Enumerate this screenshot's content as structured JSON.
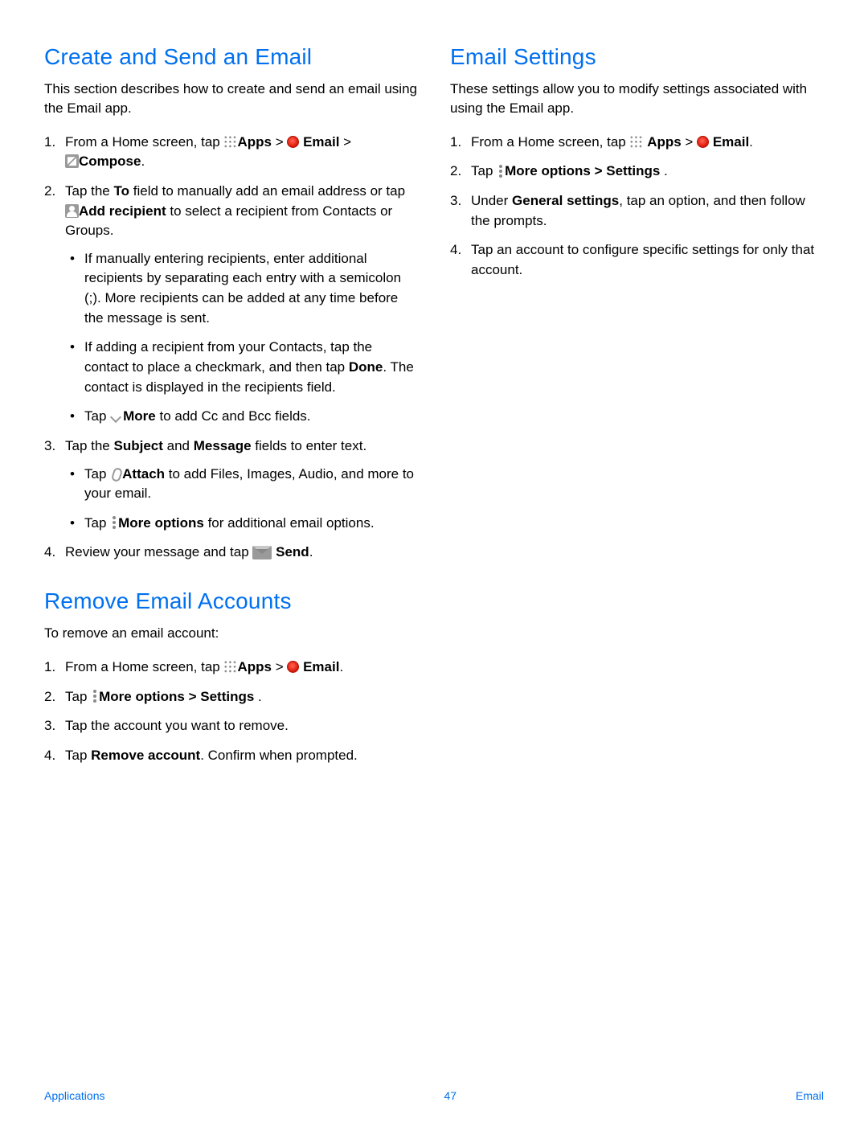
{
  "left": {
    "section1": {
      "heading": "Create and Send an Email",
      "intro": "This section describes how to create and send an email using the Email app.",
      "step1_a": "From a Home screen, tap ",
      "apps": "Apps",
      "gt": " > ",
      "email": "Email",
      "compose": "Compose",
      "period": ".",
      "step2_a": "Tap the ",
      "to": "To",
      "step2_b": " field to manually add an email address or tap ",
      "addrecipient": "Add recipient",
      "step2_c": " to select a recipient from Contacts or Groups.",
      "bullet1": "If manually entering recipients, enter additional recipients by separating each entry with a semicolon (;). More recipients can be added at any time before the message is sent.",
      "bullet2_a": "If adding a recipient from your Contacts, tap the contact to place a checkmark, and then tap ",
      "done": "Done",
      "bullet2_b": ". The contact is displayed in the recipients field.",
      "bullet3_a": "Tap ",
      "more": "More",
      "bullet3_b": " to add Cc and Bcc fields.",
      "step3_a": "Tap the ",
      "subject": "Subject",
      "and": " and ",
      "message": "Message",
      "step3_b": " fields to enter text.",
      "bullet4_a": "Tap ",
      "attach": "Attach",
      "bullet4_b": " to add Files, Images, Audio, and more to your email.",
      "bullet5_a": "Tap ",
      "moreoptions": "More options",
      "bullet5_b": " for additional email options.",
      "step4_a": "Review your message and tap ",
      "send": " Send"
    },
    "section2": {
      "heading": "Remove Email Accounts",
      "intro": "To remove an email account:",
      "step1_a": "From a Home screen, tap ",
      "apps": "Apps",
      "gt": " >  ",
      "email": "Email",
      "period": ".",
      "step2_a": "Tap ",
      "moreoptions": "More options",
      "gt2": " > ",
      "settings": "Settings",
      "step3": "Tap the account you want to remove.",
      "step4_a": "Tap ",
      "removeaccount": "Remove account",
      "step4_b": ". Confirm when prompted."
    }
  },
  "right": {
    "section1": {
      "heading": "Email Settings",
      "intro": "These settings allow you to modify settings associated with using the Email app.",
      "step1_a": "From a Home screen, tap ",
      "apps": "Apps",
      "gt": " > ",
      "email": "Email",
      "period": ".",
      "step2_a": "Tap ",
      "moreoptions": "More options",
      "gt2": " > ",
      "settings": "Settings",
      "step3_a": "Under ",
      "general": "General settings",
      "step3_b": ", tap an option, and then follow the prompts.",
      "step4": "Tap an account to configure specific settings for only that account."
    }
  },
  "footer": {
    "left": "Applications",
    "center": "47",
    "right": "Email"
  }
}
